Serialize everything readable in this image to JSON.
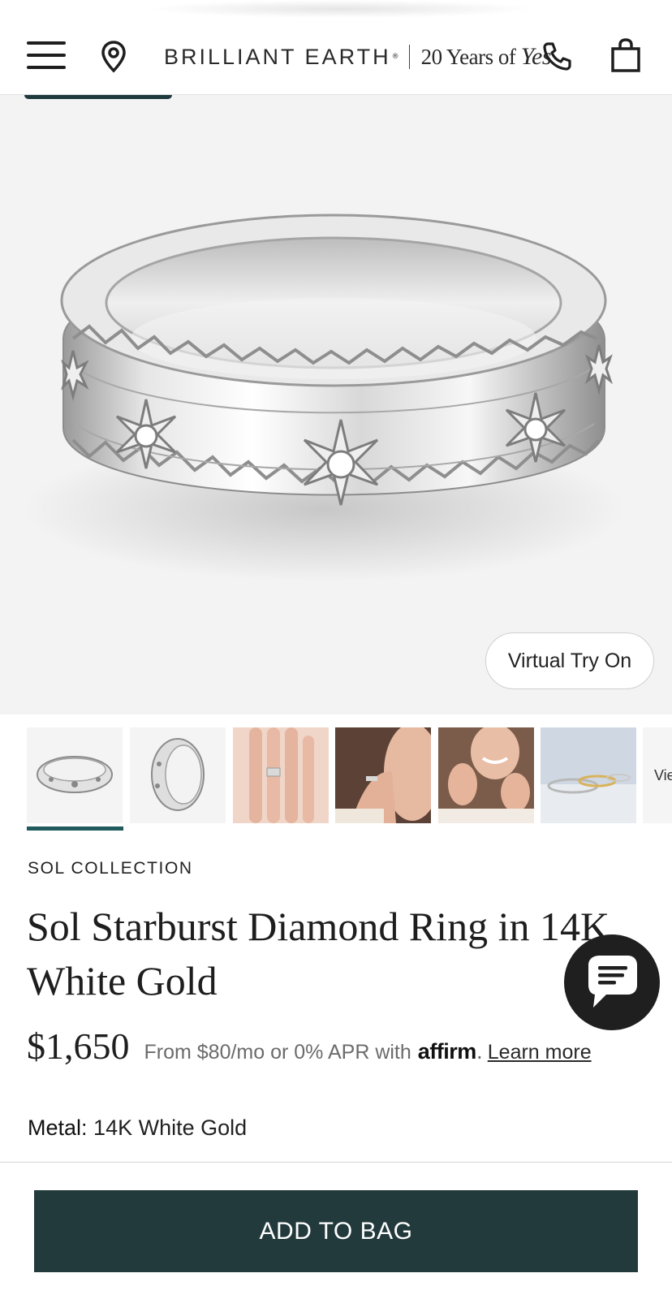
{
  "header": {
    "brand_name": "BRILLIANT EARTH",
    "brand_registered": "®",
    "tagline_prefix": "20 Years of ",
    "tagline_script": "Yes"
  },
  "hero": {
    "virtual_try_on_label": "Virtual Try On"
  },
  "thumbnails": {
    "count": 6,
    "active_index": 0,
    "more_label": "View"
  },
  "product": {
    "collection": "SOL COLLECTION",
    "title": "Sol Starburst Diamond Ring in 14K White Gold",
    "price": "$1,650",
    "financing_text": "From $80/mo or 0% APR with",
    "financing_brand": "affirm",
    "financing_link": "Learn more",
    "metal_label": "Metal:",
    "metal_value": "14K White Gold"
  },
  "actions": {
    "add_to_bag": "ADD TO BAG"
  },
  "colors": {
    "primary_button": "#223a3c",
    "active_thumb_bar": "#1f5a5c",
    "chat_button": "#1f1f1f"
  },
  "icons": [
    "menu-icon",
    "location-pin-icon",
    "phone-icon",
    "shopping-bag-icon",
    "chat-icon"
  ]
}
